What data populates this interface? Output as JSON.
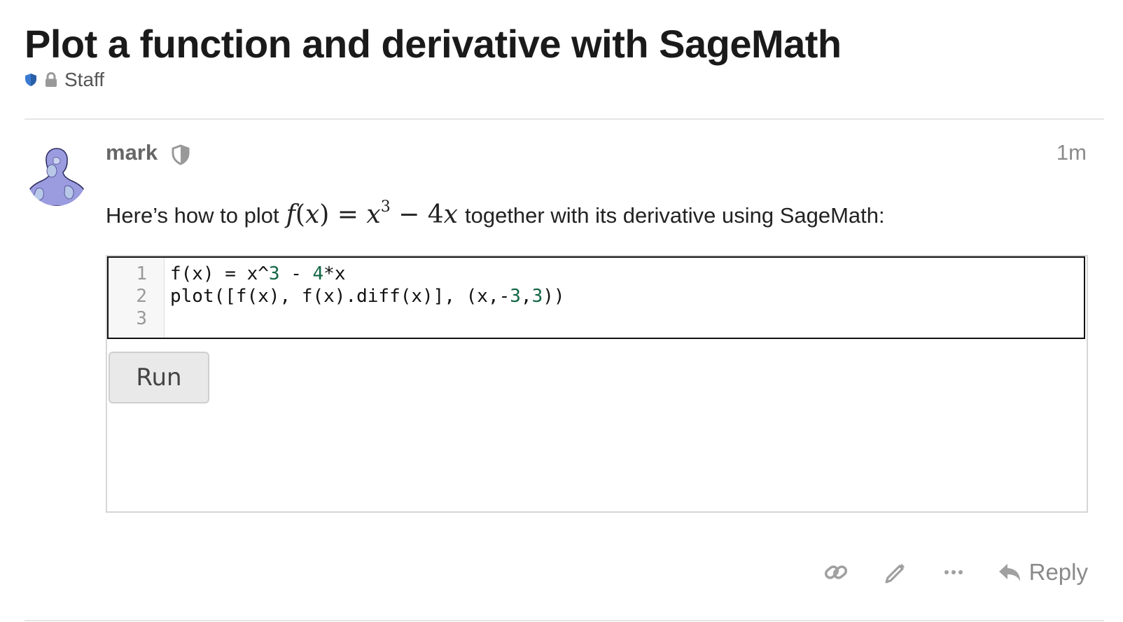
{
  "topic": {
    "title": "Plot a function and derivative with SageMath",
    "category": "Staff",
    "category_icon_color": "#3b7ad1",
    "icons": [
      "shield-icon",
      "lock-icon"
    ]
  },
  "post": {
    "username": "mark",
    "user_badge_icon": "shield-icon",
    "time": "1m",
    "text_before": "Here’s how to plot",
    "math": {
      "f": "f",
      "x": "x",
      "eq": "=",
      "base": "x",
      "exponent": "3",
      "minus": "−",
      "coef": "4",
      "var": "x"
    },
    "text_after": "together with its derivative using SageMath:"
  },
  "sage_cell": {
    "line_numbers": [
      "1",
      "2",
      "3"
    ],
    "code": {
      "line1": {
        "a": "f(x) = x^",
        "b": "3",
        "c": " - ",
        "d": "4",
        "e": "*x"
      },
      "line2": {
        "a": "plot([f(x), f(x).diff(x)], (x,-",
        "b": "3",
        "c": ",",
        "d": "3",
        "e": "))"
      },
      "line3": ""
    },
    "run_label": "Run"
  },
  "actions": {
    "icons": [
      "link-icon",
      "pencil-icon",
      "more-icon",
      "reply-icon"
    ],
    "reply_label": "Reply"
  },
  "colors": {
    "number_token": "#116644",
    "avatar_fill": "#9b9be0"
  }
}
